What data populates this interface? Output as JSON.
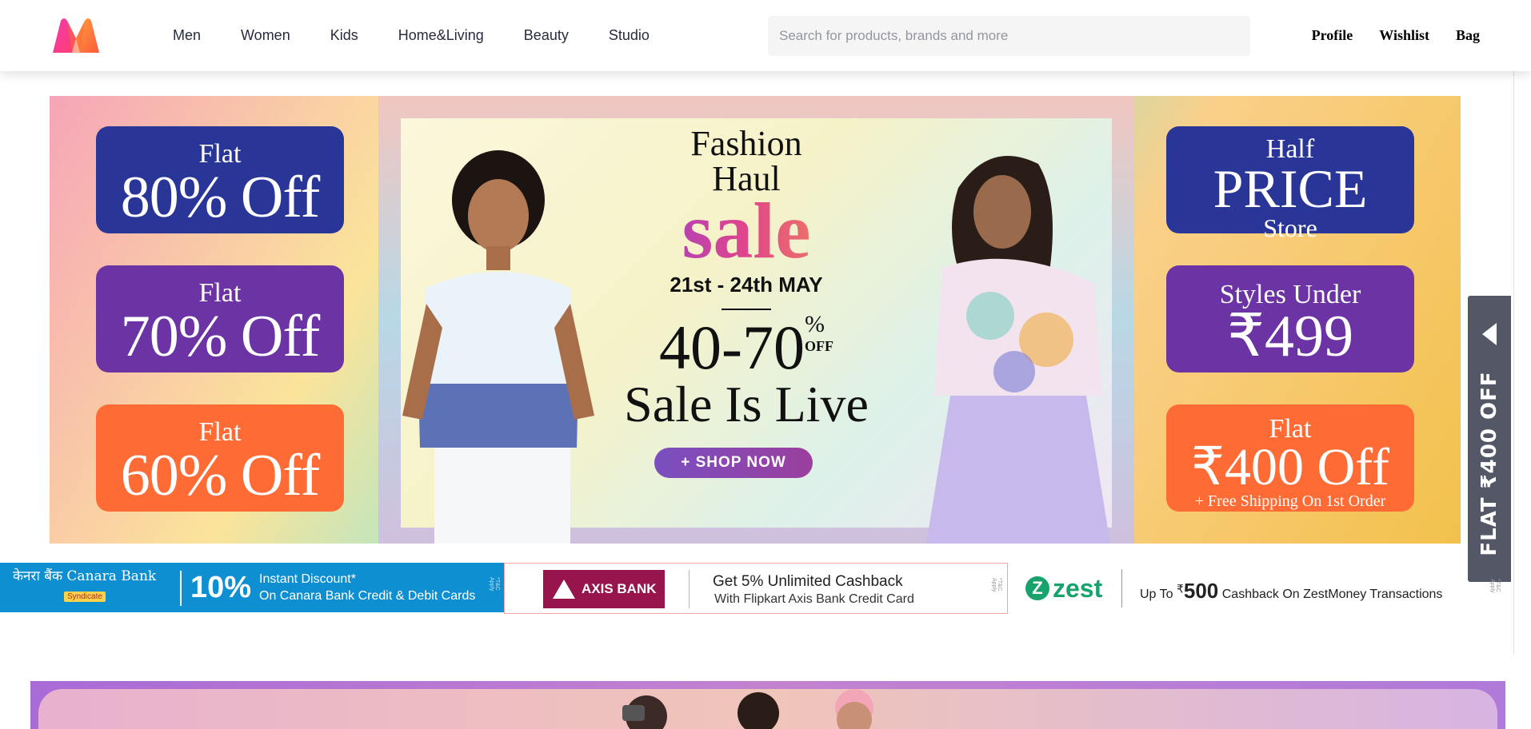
{
  "header": {
    "nav": [
      "Men",
      "Women",
      "Kids",
      "Home&Living",
      "Beauty",
      "Studio"
    ],
    "search_placeholder": "Search for products, brands and more",
    "actions": [
      "Profile",
      "Wishlist",
      "Bag"
    ]
  },
  "hero": {
    "left_pills": [
      {
        "small": "Flat",
        "big": "80% Off"
      },
      {
        "small": "Flat",
        "big": "70% Off"
      },
      {
        "small": "Flat",
        "big": "60% Off"
      }
    ],
    "center": {
      "line1": "Fashion",
      "line2": "Haul",
      "line3": "sale",
      "dates": "21st - 24th MAY",
      "range": "40-70",
      "range_suffix_top": "%",
      "range_suffix_bottom": "OFF",
      "live": "Sale Is Live",
      "cta": "+ SHOP NOW"
    },
    "right_pills": [
      {
        "small": "Half",
        "big": "PRICE",
        "small2": "Store"
      },
      {
        "small": "Styles Under",
        "big": "₹499"
      },
      {
        "small": "Flat",
        "big": "₹400 Off",
        "note": "+ Free Shipping On 1st Order"
      }
    ]
  },
  "side_tab": {
    "label": "FLAT ₹400 OFF"
  },
  "banks": {
    "canara": {
      "logo_hi": "केनरा बैंक",
      "logo_en": "Canara Bank",
      "sub": "Syndicate",
      "percent": "10%",
      "line1": "Instant Discount*",
      "line2": "On Canara Bank Credit & Debit Cards",
      "tnc": "*T&C Apply"
    },
    "axis": {
      "logo": "AXIS BANK",
      "line1": "Get 5% Unlimited Cashback",
      "line2": "With Flipkart Axis Bank Credit Card",
      "tnc": "*T&C Apply"
    },
    "zest": {
      "logo": "zest",
      "prefix": "Up To",
      "currency": "₹",
      "amount": "500",
      "suffix": "Cashback On ZestMoney Transactions",
      "tnc": "*T&C Apply"
    }
  }
}
